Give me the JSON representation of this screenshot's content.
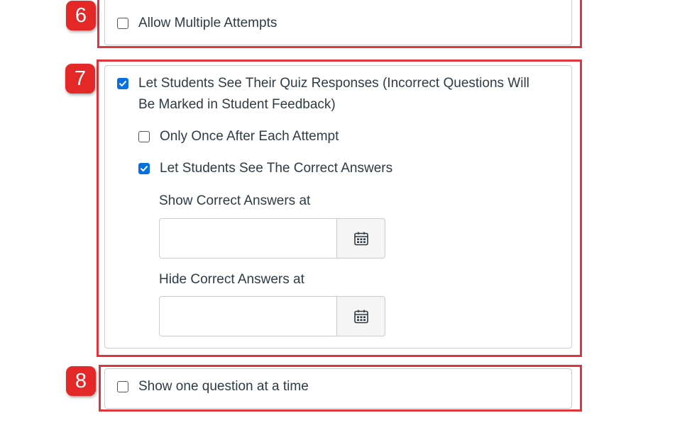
{
  "badges": {
    "six": "6",
    "seven": "7",
    "eight": "8"
  },
  "options": {
    "allow_multiple_attempts": {
      "label": "Allow Multiple Attempts",
      "checked": false
    },
    "see_responses": {
      "label_line1": "Let Students See Their Quiz Responses (Incorrect Questions Will",
      "label_line2": "Be Marked in Student Feedback)",
      "checked": true
    },
    "only_once": {
      "label": "Only Once After Each Attempt",
      "checked": false
    },
    "see_correct": {
      "label": "Let Students See The Correct Answers",
      "checked": true
    },
    "show_correct_at": {
      "label": "Show Correct Answers at",
      "value": ""
    },
    "hide_correct_at": {
      "label": "Hide Correct Answers at",
      "value": ""
    },
    "one_question": {
      "label": "Show one question at a time",
      "checked": false
    }
  },
  "icons": {
    "calendar": "calendar-icon",
    "check": "checkmark-icon"
  },
  "colors": {
    "highlight": "#e0353d",
    "badge": "#e42828",
    "checkbox_checked": "#0770e0"
  }
}
